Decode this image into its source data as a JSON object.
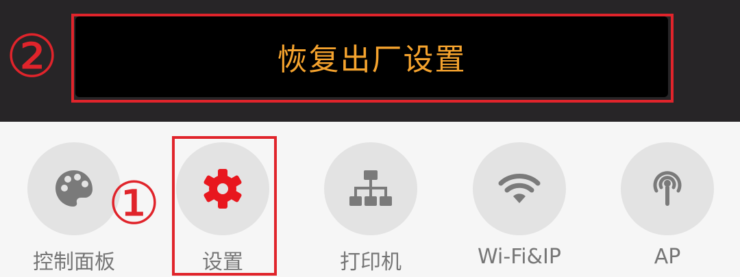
{
  "reset_button": {
    "label": "恢复出厂设置"
  },
  "annotations": {
    "step_1": "①",
    "step_2": "②"
  },
  "tabs": [
    {
      "label": "控制面板",
      "icon": "palette-icon"
    },
    {
      "label": "设置",
      "icon": "gear-icon"
    },
    {
      "label": "打印机",
      "icon": "network-tree-icon"
    },
    {
      "label": "Wi-Fi&IP",
      "icon": "wifi-icon"
    },
    {
      "label": "AP",
      "icon": "antenna-icon"
    }
  ],
  "colors": {
    "top_bar": "#272527",
    "reset_text": "#f5a32e",
    "highlight": "#e0242b",
    "icon_gray": "#7a7a7a",
    "icon_active": "#e8171e",
    "circle_bg": "#e3e3e3"
  }
}
